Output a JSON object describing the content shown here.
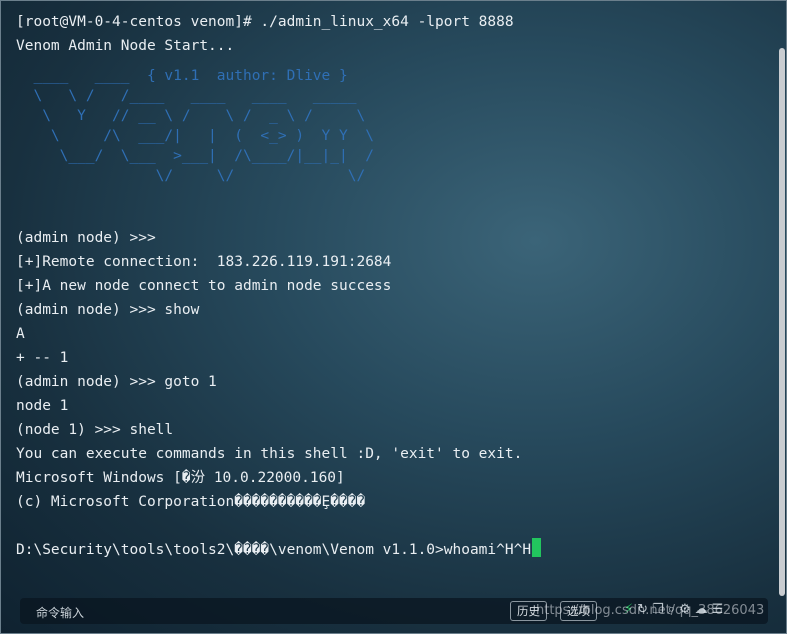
{
  "terminal": {
    "lines_top": [
      "[root@VM-0-4-centos venom]# ./admin_linux_x64 -lport 8888",
      "Venom Admin Node Start..."
    ],
    "banner": "  ____   ____  { v1.1  author: Dlive }\n  \\   \\ /   /____   ____   ____   _____\n   \\   Y   // __ \\ /    \\ /  _ \\ /     \\\n    \\     /\\  ___/|   |  (  <_> )  Y Y  \\\n     \\___/  \\___  >___|  /\\____/|__|_|  /\n                \\/     \\/             \\/",
    "lines_bottom": [
      "",
      "(admin node) >>>",
      "[+]Remote connection:  183.226.119.191:2684",
      "[+]A new node connect to admin node success",
      "(admin node) >>> show",
      "A",
      "+ -- 1",
      "(admin node) >>> goto 1",
      "node 1",
      "(node 1) >>> shell",
      "You can execute commands in this shell :D, 'exit' to exit.",
      "Microsoft Windows [�汾 10.0.22000.160]",
      "(c) Microsoft Corporation����������Ȩ����",
      ""
    ],
    "prompt": "D:\\Security\\tools\\tools2\\����\\venom\\Venom v1.1.0>whoami^H^H"
  },
  "input_bar": {
    "placeholder": "命令输入",
    "history_button": "历史",
    "options_button": "选项"
  },
  "tool_icons": [
    "bolt-icon",
    "refresh-icon",
    "copy-icon",
    "search-icon",
    "gear-icon",
    "cloud-icon",
    "menu-icon"
  ],
  "watermark": "https://blog.csdn.net/qq_38626043",
  "colors": {
    "text": "#e9eef2",
    "banner": "#2f6fb5",
    "cursor": "#22c55e"
  }
}
